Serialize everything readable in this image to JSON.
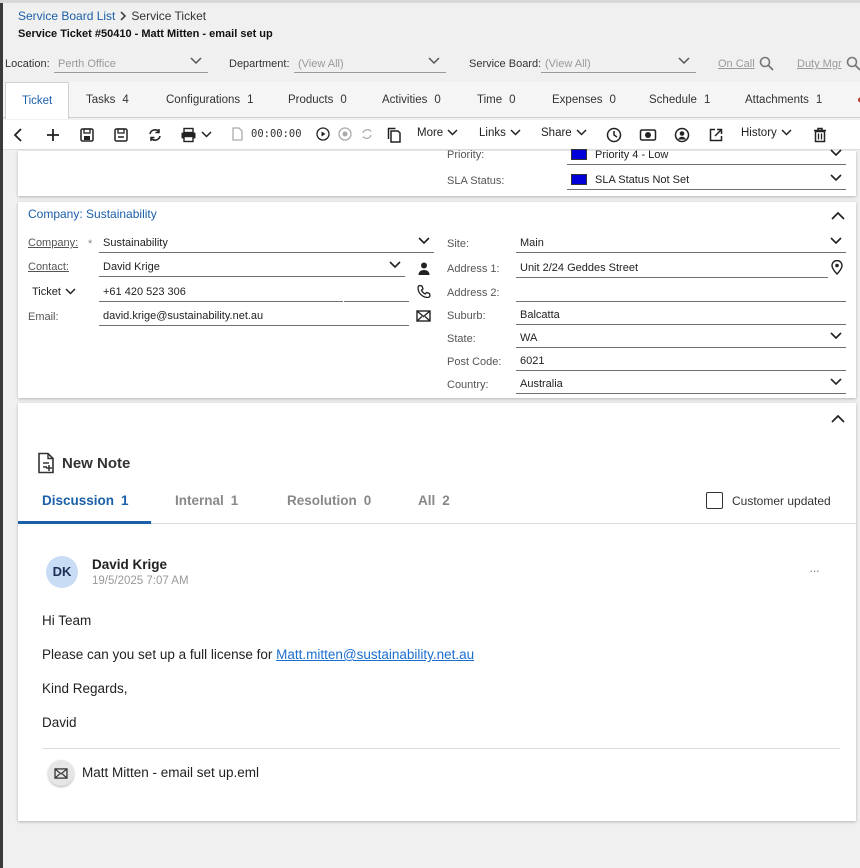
{
  "breadcrumb": {
    "link": "Service Board List",
    "current": "Service Ticket"
  },
  "title": "Service Ticket #50410 - Matt Mitten - email set up",
  "filters": {
    "location_label": "Location:",
    "location_value": "Perth Office",
    "department_label": "Department:",
    "department_value": "(View All)",
    "board_label": "Service Board:",
    "board_value": "(View All)",
    "on_call": "On Call",
    "duty_mgr": "Duty Mgr"
  },
  "tabs": [
    {
      "label": "Ticket",
      "count": ""
    },
    {
      "label": "Tasks",
      "count": "4"
    },
    {
      "label": "Configurations",
      "count": "1"
    },
    {
      "label": "Products",
      "count": "0"
    },
    {
      "label": "Activities",
      "count": "0"
    },
    {
      "label": "Time",
      "count": "0"
    },
    {
      "label": "Expenses",
      "count": "0"
    },
    {
      "label": "Schedule",
      "count": "1"
    },
    {
      "label": "Attachments",
      "count": "1"
    }
  ],
  "toolbar": {
    "timer": "00:00:00",
    "more": "More",
    "links": "Links",
    "share": "Share",
    "history": "History"
  },
  "status": {
    "priority_label": "Priority:",
    "priority_value": "Priority 4 - Low",
    "sla_label": "SLA Status:",
    "sla_value": "SLA Status Not Set",
    "swatch_color": "#0000d8"
  },
  "company_card": {
    "title": "Company: Sustainability",
    "company_label": "Company:",
    "required_mark": "*",
    "company_value": "Sustainability",
    "contact_label": "Contact:",
    "contact_value": "David Krige",
    "phone_type": "Ticket",
    "phone_value": "+61 420 523 306",
    "email_label": "Email:",
    "email_value": "david.krige@sustainability.net.au",
    "site_label": "Site:",
    "site_value": "Main",
    "address1_label": "Address 1:",
    "address1_value": "Unit 2/24 Geddes Street",
    "address2_label": "Address 2:",
    "address2_value": "",
    "suburb_label": "Suburb:",
    "suburb_value": "Balcatta",
    "state_label": "State:",
    "state_value": "WA",
    "postcode_label": "Post Code:",
    "postcode_value": "6021",
    "country_label": "Country:",
    "country_value": "Australia"
  },
  "notes": {
    "new_note": "New Note",
    "tabs": [
      {
        "label": "Discussion",
        "count": "1"
      },
      {
        "label": "Internal",
        "count": "1"
      },
      {
        "label": "Resolution",
        "count": "0"
      },
      {
        "label": "All",
        "count": "2"
      }
    ],
    "customer_updated": "Customer updated",
    "entry": {
      "initials": "DK",
      "author": "David Krige",
      "timestamp": "19/5/2025 7:07 AM",
      "menu": "···",
      "greeting": "Hi Team",
      "line_prefix": "Please can you set up a full license for ",
      "link": "Matt.mitten@sustainability.net.au",
      "closing": "Kind Regards,",
      "signature": "David",
      "attachment": "Matt Mitten - email set up.eml"
    }
  },
  "colors": {
    "accent": "#1b5fa8",
    "link": "#1b6fd0",
    "avatar_bg": "#c9dcf5"
  }
}
